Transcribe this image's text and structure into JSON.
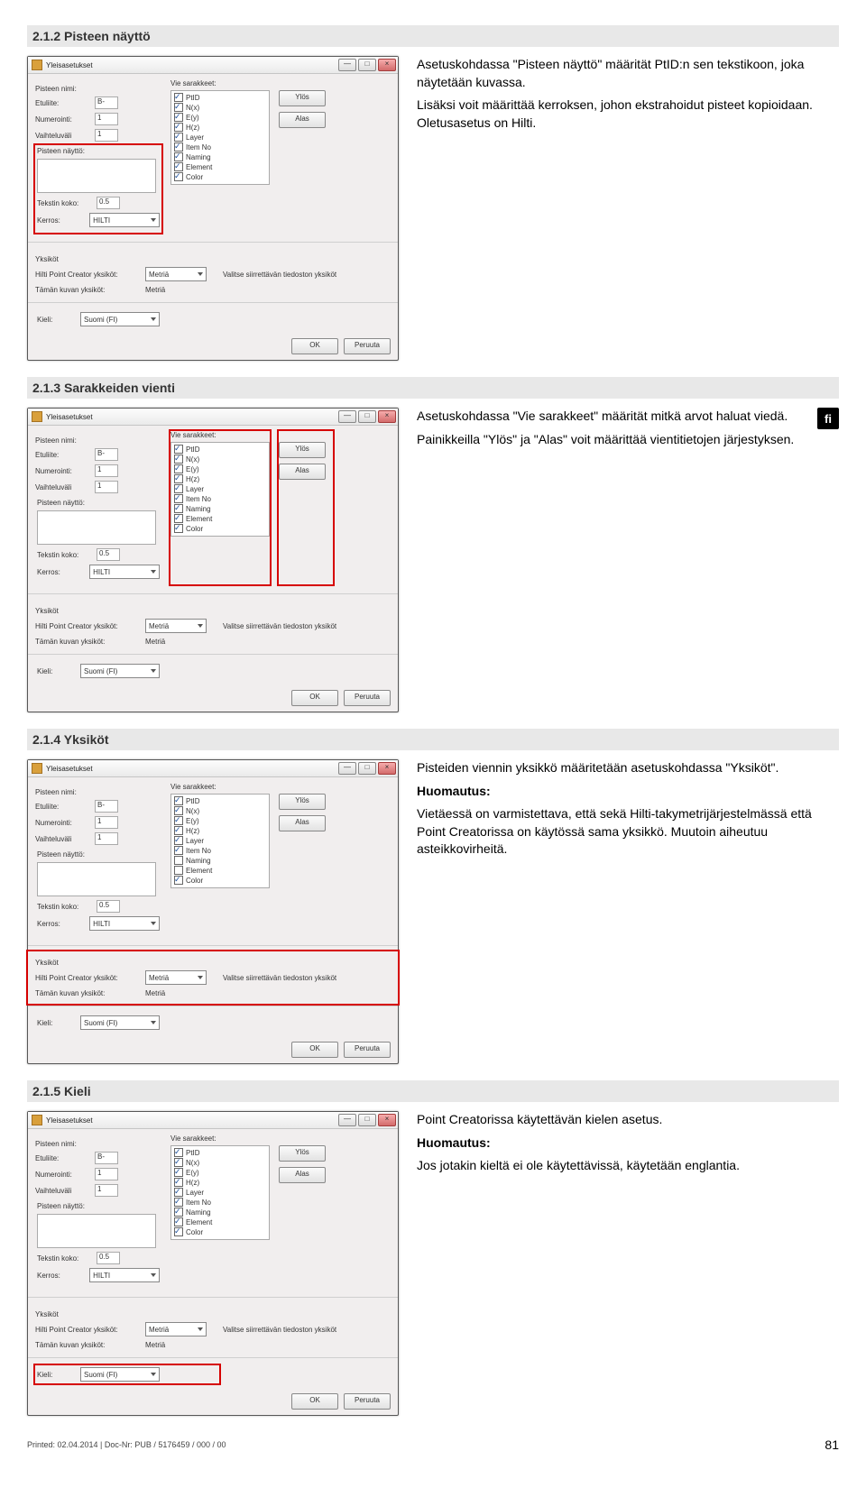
{
  "sections": [
    {
      "heading": "2.1.2 Pisteen näyttö",
      "highlight": "pisteen_display",
      "text": [
        "Asetuskohdassa \"Pisteen näyttö\" määrität PtID:n sen tekstikoon, joka näytetään kuvassa.",
        "Lisäksi voit määrittää kerroksen, johon ekstrahoidut pisteet kopioidaan. Oletusasetus on Hilti."
      ],
      "tab": false
    },
    {
      "heading": "2.1.3 Sarakkeiden vienti",
      "highlight": "sarakkeet",
      "text": [
        "Asetuskohdassa \"Vie sarakkeet\" määrität mitkä arvot haluat viedä.",
        "Painikkeilla \"Ylös\" ja \"Alas\" voit määrittää vientitietojen järjestyksen."
      ],
      "tab": true
    },
    {
      "heading": "2.1.4 Yksiköt",
      "highlight": "units",
      "text": [
        "Pisteiden viennin yksikkö määritetään asetuskohdassa \"Yksiköt\".",
        "<strong>Huomautus:</strong>",
        "Vietäessä on varmistettava, että sekä Hilti-takymetrijärjestelmässä että Point Creatorissa on käytössä sama yksikkö. Muutoin aiheutuu asteikkovirheitä."
      ],
      "tab": false
    },
    {
      "heading": "2.1.5 Kieli",
      "highlight": "kieli",
      "text": [
        "Point Creatorissa käytettävän kielen asetus.",
        "<strong>Huomautus:</strong>",
        "Jos jotakin kieltä ei ole käytettävissä, käytetään englantia."
      ],
      "tab": false
    }
  ],
  "dialog": {
    "title": "Yleisasetukset",
    "labels": {
      "pisteen_nimi": "Pisteen nimi:",
      "etuliite": "Etuliite:",
      "numerointi": "Numerointi:",
      "vaihteluvali": "Vaihteluväli",
      "pisteen_naytto": "Pisteen näyttö:",
      "tekstin_koko": "Tekstin koko:",
      "kerros": "Kerros:",
      "vie_sarakkeet": "Vie sarakkeet:",
      "ylos": "Ylös",
      "alas": "Alas",
      "units_header": "Yksiköt",
      "hpc_units": "Hilti Point Creator yksiköt:",
      "valitse_units": "Valitse siirrettävän tiedoston yksiköt",
      "taman_kuvan": "Tämän kuvan yksiköt:",
      "kieli": "Kieli:",
      "ok": "OK",
      "peruuta": "Peruuta"
    },
    "values": {
      "etuliite": "B-",
      "numerointi": "1",
      "vaihteluvali": "1",
      "tekstin_koko": "0.5",
      "kerros": "HILTI",
      "hpc_units": "Metriä",
      "taman_kuvan": "Metriä",
      "kieli": "Suomi (FI)"
    },
    "columns": [
      "PtID",
      "N(x)",
      "E(y)",
      "H(z)",
      "Layer",
      "Item No",
      "Naming",
      "Element",
      "Color"
    ]
  },
  "lang_tab": "fi",
  "footer": {
    "left": "Printed: 02.04.2014 | Doc-Nr: PUB / 5176459 / 000 / 00",
    "right": "81"
  }
}
